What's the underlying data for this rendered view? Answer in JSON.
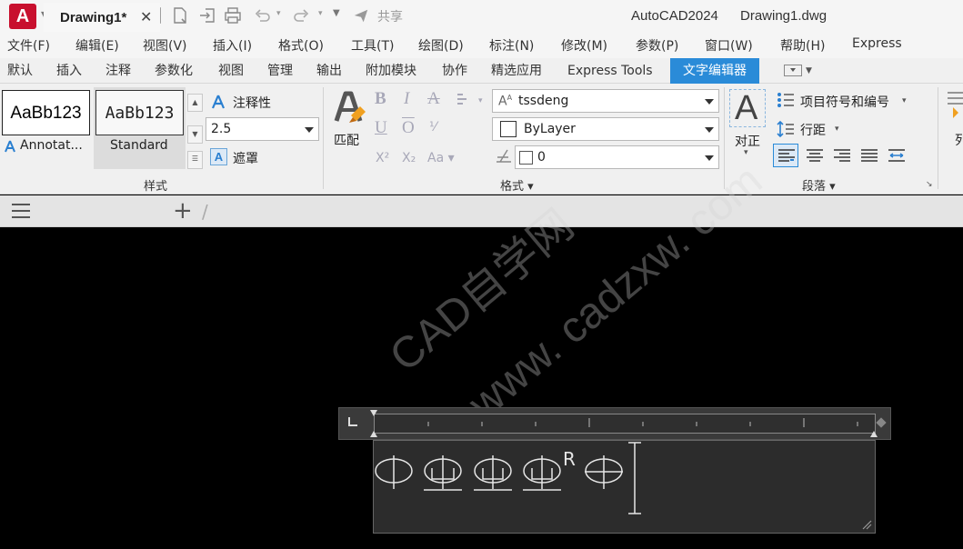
{
  "titlebar": {
    "app_logo": "A",
    "share_label": "共享",
    "app_name": "AutoCAD2024",
    "document": "Drawing1.dwg"
  },
  "menu": [
    "文件(F)",
    "编辑(E)",
    "视图(V)",
    "插入(I)",
    "格式(O)",
    "工具(T)",
    "绘图(D)",
    "标注(N)",
    "修改(M)",
    "参数(P)",
    "窗口(W)",
    "帮助(H)",
    "Express"
  ],
  "ribbon_tabs": [
    "默认",
    "插入",
    "注释",
    "参数化",
    "视图",
    "管理",
    "输出",
    "附加模块",
    "协作",
    "精选应用",
    "Express Tools",
    "文字编辑器"
  ],
  "active_tab": "文字编辑器",
  "style_panel": {
    "title": "样式",
    "swatches": [
      {
        "preview": "AaBb123",
        "name": "Annotat..."
      },
      {
        "preview": "AaBb123",
        "name": "Standard"
      }
    ],
    "annotative_label": "注释性",
    "height_value": "2.5",
    "mask_label": "遮罩"
  },
  "format_panel": {
    "title": "格式",
    "match_label": "匹配",
    "font_value": "tssdeng",
    "color_value": "ByLayer",
    "oblique_value": "0"
  },
  "paragraph_panel": {
    "title": "段落",
    "justify_label": "对正",
    "bullets_label": "项目符号和编号",
    "line_spacing_label": "行距"
  },
  "columns_partial_label": "列",
  "file_tab": {
    "label": "Drawing1*",
    "close_glyph": "✕",
    "new_glyph": "+"
  },
  "watermark": {
    "line1": "CAD自学网",
    "line2": "www. cadzxw. com"
  },
  "editor_text": {
    "superscript": "R"
  },
  "colors": {
    "accent": "#2a8bd8",
    "logo_red": "#c8102e",
    "canvas": "#000000",
    "editor_bg": "#2c2c2c"
  }
}
